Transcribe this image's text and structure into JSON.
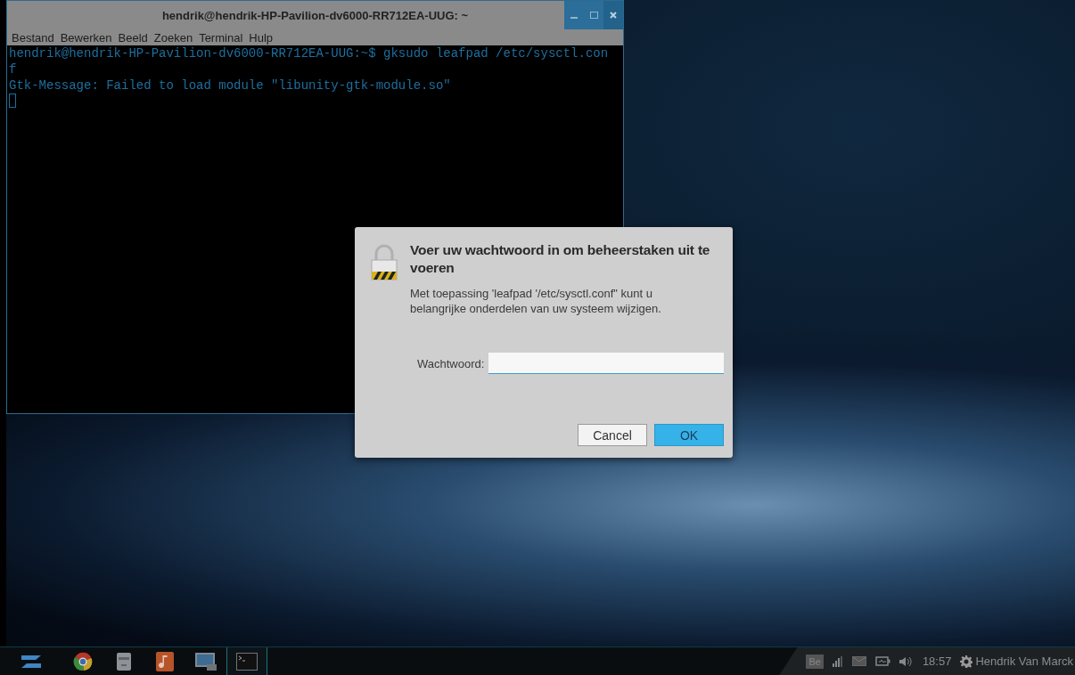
{
  "terminal": {
    "title": "hendrik@hendrik-HP-Pavilion-dv6000-RR712EA-UUG: ~",
    "menu": [
      "Bestand",
      "Bewerken",
      "Beeld",
      "Zoeken",
      "Terminal",
      "Hulp"
    ],
    "lines": [
      "hendrik@hendrik-HP-Pavilion-dv6000-RR712EA-UUG:~$ gksudo leafpad /etc/sysctl.con",
      "f",
      "Gtk-Message: Failed to load module \"libunity-gtk-module.so\""
    ]
  },
  "dialog": {
    "heading": "Voer uw wachtwoord in om beheerstaken uit te voeren",
    "message": "Met toepassing 'leafpad '/etc/sysctl.conf\" kunt u belangrijke onderdelen van uw systeem wijzigen.",
    "field_label": "Wachtwoord:",
    "buttons": [
      {
        "label": "Cancel",
        "kind": "secondary"
      },
      {
        "label": "OK",
        "kind": "primary"
      }
    ]
  },
  "taskbar": {
    "apps": [
      {
        "kind": "menu",
        "selected": false
      },
      {
        "kind": "browser",
        "selected": false
      },
      {
        "kind": "files",
        "selected": false
      },
      {
        "kind": "music",
        "selected": false
      },
      {
        "kind": "display",
        "selected": false
      },
      {
        "kind": "terminal",
        "selected": true
      }
    ],
    "keyboard_layout": "Be",
    "clock": "18:57",
    "user": "Hendrik Van Marck"
  }
}
